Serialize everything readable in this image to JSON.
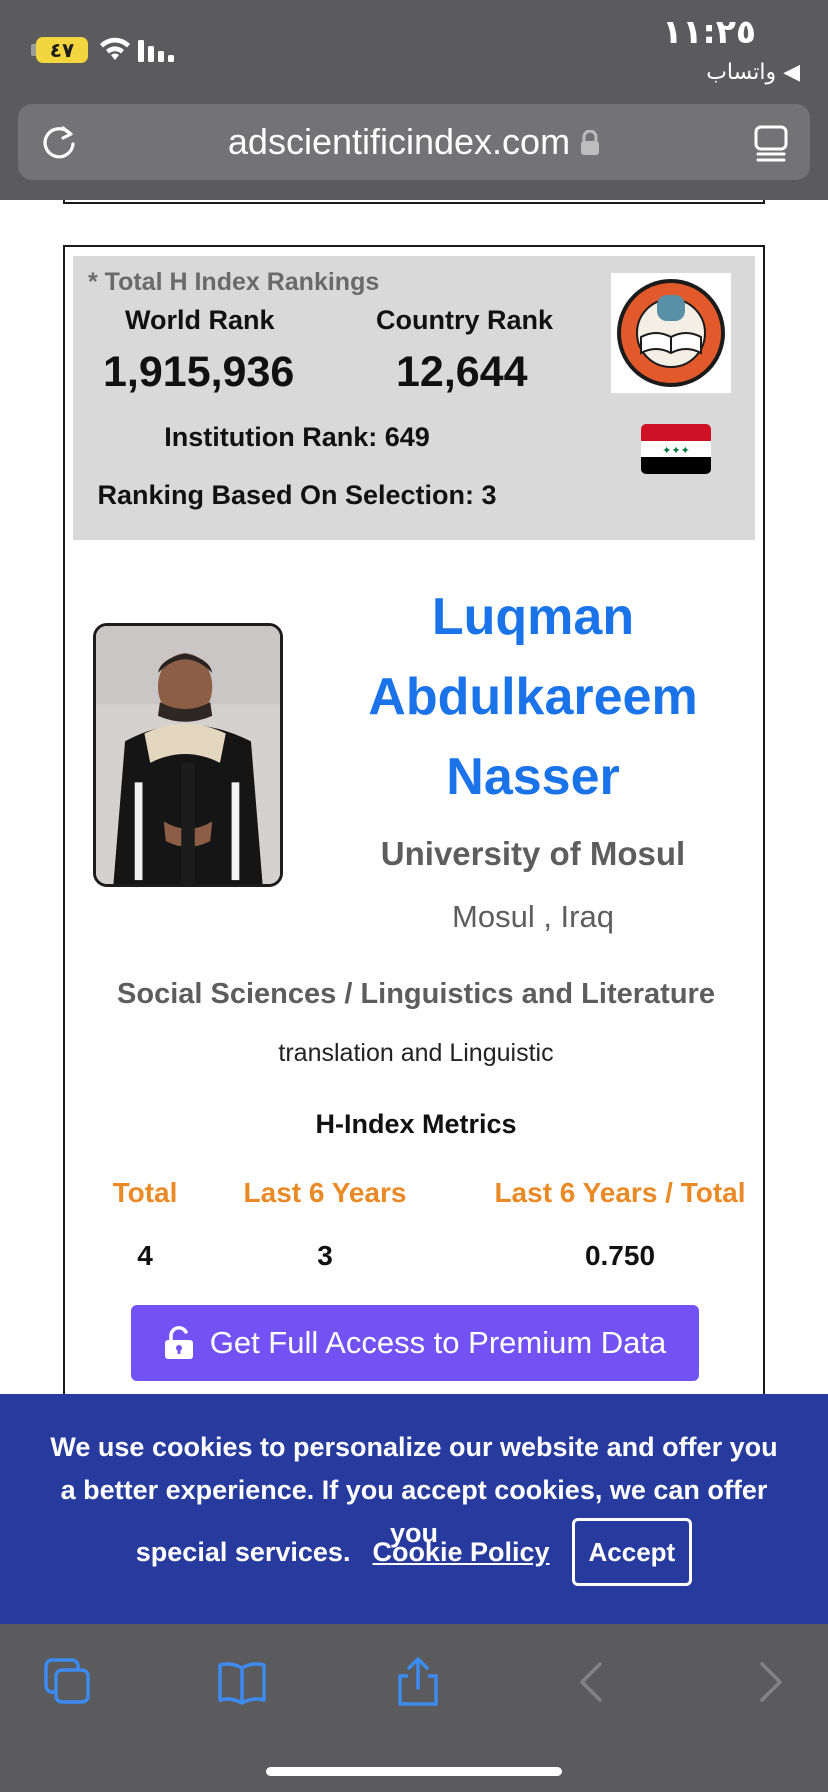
{
  "status_bar": {
    "time": "١١:٢٥",
    "battery": "٤٧",
    "back_app": "◀ واتساب"
  },
  "browser": {
    "url": "adscientificindex.com"
  },
  "rankings": {
    "title": "* Total H Index Rankings",
    "world_label": "World Rank",
    "world_value": "1,915,936",
    "country_label": "Country Rank",
    "country_value": "12,644",
    "institution": "Institution Rank: 649",
    "selection": "Ranking Based On Selection: 3"
  },
  "profile": {
    "name_line1": "Luqman",
    "name_line2": "Abdulkareem",
    "name_line3": "Nasser",
    "university": "University of Mosul",
    "location": "Mosul , Iraq",
    "field": "Social Sciences / Linguistics and Literature",
    "subfield": "translation and Linguistic"
  },
  "metrics": {
    "title": "H-Index Metrics",
    "headers": [
      "Total",
      "Last 6 Years",
      "Last 6 Years / Total"
    ],
    "values": [
      "4",
      "3",
      "0.750"
    ]
  },
  "premium_button": "Get Full Access to Premium Data",
  "cookie": {
    "text": "We use cookies to personalize our website and offer you a better experience. If you accept cookies, we can offer you",
    "text_end": "special services.",
    "policy_link": "Cookie Policy",
    "accept": "Accept"
  },
  "colors": {
    "name": "#1a73e8",
    "metric_header": "#ea8a26",
    "premium": "#7252f5",
    "cookie_bg": "#263b9d"
  }
}
